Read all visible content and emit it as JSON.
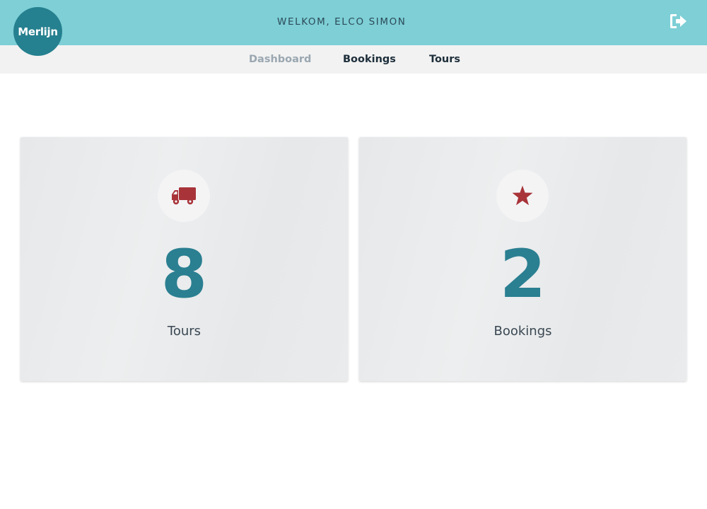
{
  "brand": {
    "logo_text": "Merlijn"
  },
  "header": {
    "welcome": "WELKOM, ELCO SIMON",
    "logout_icon": "sign-out-icon"
  },
  "nav": {
    "items": [
      {
        "label": "Dashboard",
        "active": true
      },
      {
        "label": "Bookings",
        "active": false
      },
      {
        "label": "Tours",
        "active": false
      }
    ]
  },
  "stats": [
    {
      "icon": "truck-icon",
      "value": "8",
      "label": "Tours"
    },
    {
      "icon": "star-icon",
      "value": "2",
      "label": "Bookings"
    }
  ],
  "colors": {
    "header_bg": "#7ecfd6",
    "logo_bg": "#25808f",
    "count_color": "#2a7f91",
    "icon_color": "#a8343a",
    "nav_active": "#9aa7b1"
  }
}
